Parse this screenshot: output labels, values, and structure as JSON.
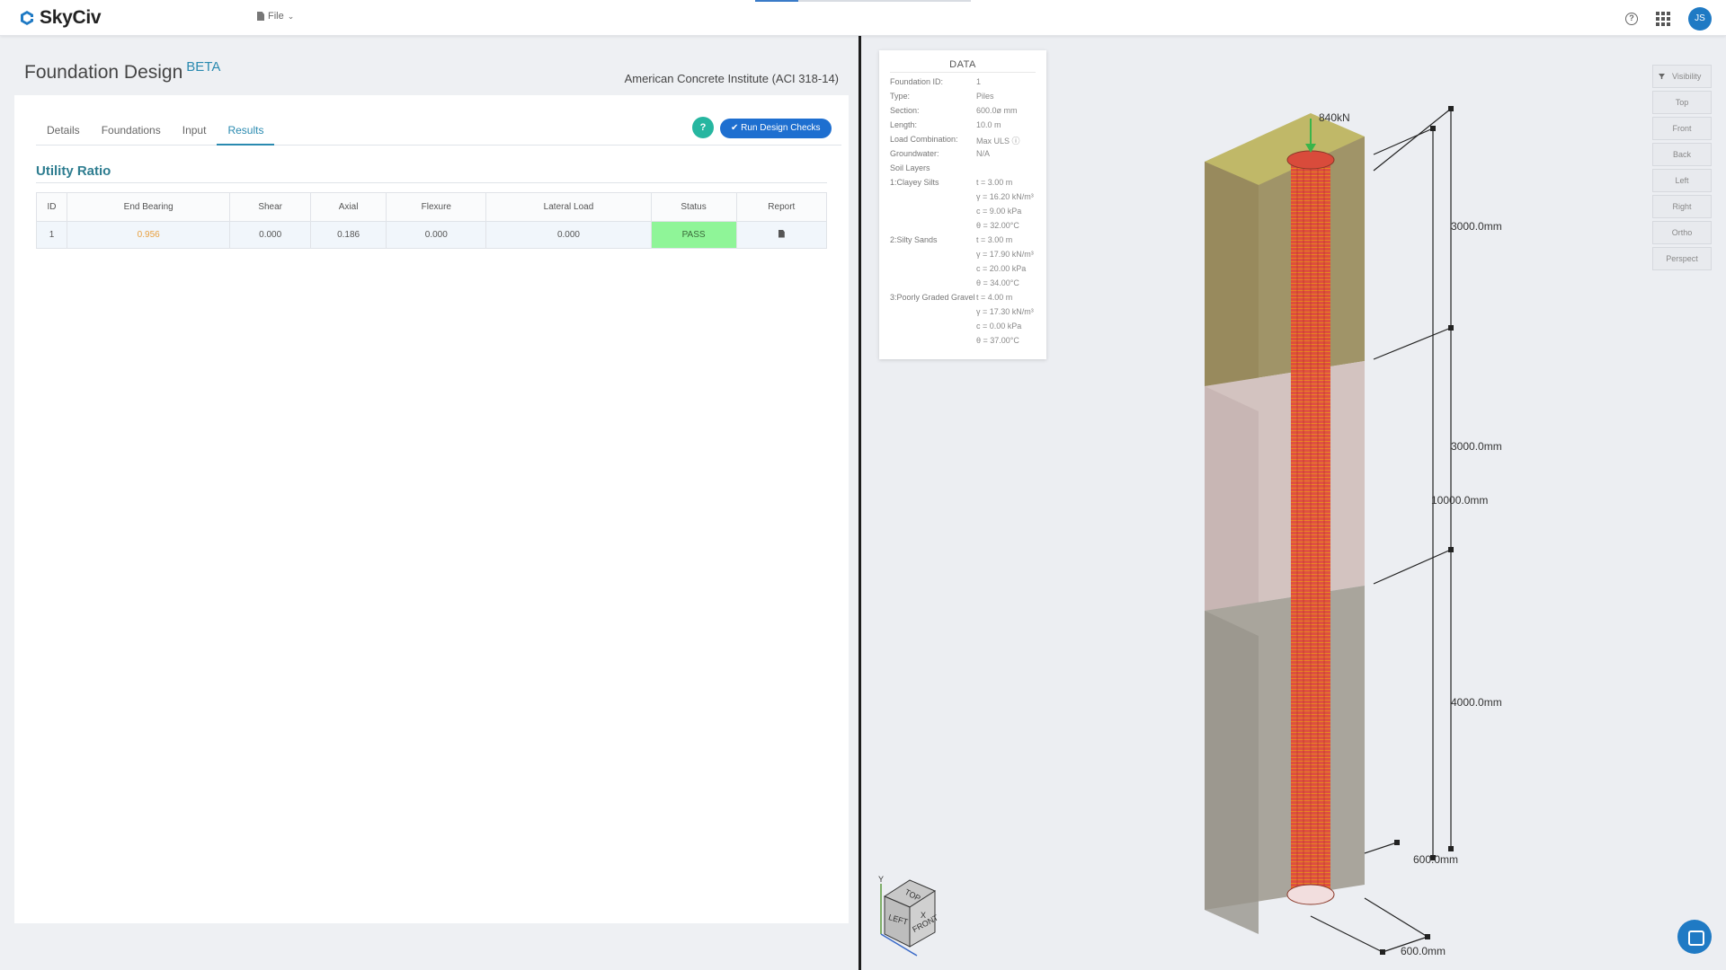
{
  "app": {
    "brand": "SkyCiv",
    "file_menu": "File",
    "user_initials": "JS"
  },
  "page": {
    "title": "Foundation Design",
    "badge": "BETA",
    "code": "American Concrete Institute (ACI 318-14)"
  },
  "tabs": [
    {
      "label": "Details"
    },
    {
      "label": "Foundations"
    },
    {
      "label": "Input"
    },
    {
      "label": "Results"
    }
  ],
  "active_tab": "Results",
  "actions": {
    "help": "?",
    "run": "Run Design Checks"
  },
  "results": {
    "title": "Utility Ratio",
    "columns": [
      "ID",
      "End Bearing",
      "Shear",
      "Axial",
      "Flexure",
      "Lateral Load",
      "Status",
      "Report"
    ],
    "rows": [
      {
        "id": "1",
        "end_bearing": "0.956",
        "shear": "0.000",
        "axial": "0.186",
        "flexure": "0.000",
        "lateral": "0.000",
        "status": "PASS"
      }
    ]
  },
  "data_panel": {
    "title": "DATA",
    "foundation_id_label": "Foundation ID:",
    "foundation_id": "1",
    "type_label": "Type:",
    "type": "Piles",
    "section_label": "Section:",
    "section": "600.0ø mm",
    "length_label": "Length:",
    "length": "10.0 m",
    "load_combo_label": "Load Combination:",
    "load_combo": "Max ULS",
    "groundwater_label": "Groundwater:",
    "groundwater": "N/A",
    "soil_layers_label": "Soil Layers",
    "layers": [
      {
        "name": "1:Clayey Silts",
        "t": "t = 3.00 m",
        "gamma": "γ = 16.20 kN/m³",
        "c": "c = 9.00 kPa",
        "theta": "θ = 32.00°C"
      },
      {
        "name": "2:Silty Sands",
        "t": "t = 3.00 m",
        "gamma": "γ = 17.90 kN/m³",
        "c": "c = 20.00 kPa",
        "theta": "θ = 34.00°C"
      },
      {
        "name": "3:Poorly Graded Gravel",
        "t": "t = 4.00 m",
        "gamma": "γ = 17.30 kN/m³",
        "c": "c = 0.00 kPa",
        "theta": "θ = 37.00°C"
      }
    ]
  },
  "view_buttons": {
    "visibility": "Visibility",
    "top": "Top",
    "front": "Front",
    "back": "Back",
    "left": "Left",
    "right": "Right",
    "ortho": "Ortho",
    "perspect": "Perspect"
  },
  "model_labels": {
    "load": "840kN",
    "layer1": "3000.0mm",
    "layer2": "3000.0mm",
    "total": "10000.0mm",
    "layer3": "4000.0mm",
    "diameter": "600.0mm",
    "width": "600.0mm"
  },
  "nav_cube": {
    "top": "TOP",
    "left": "LEFT",
    "front": "FRONT",
    "y": "Y",
    "x": "X"
  },
  "colors": {
    "accent": "#2a8ab0",
    "run_button": "#1e6fd0",
    "pass": "#8ff598",
    "warn": "#e8a040",
    "pile": "#e0453a"
  }
}
